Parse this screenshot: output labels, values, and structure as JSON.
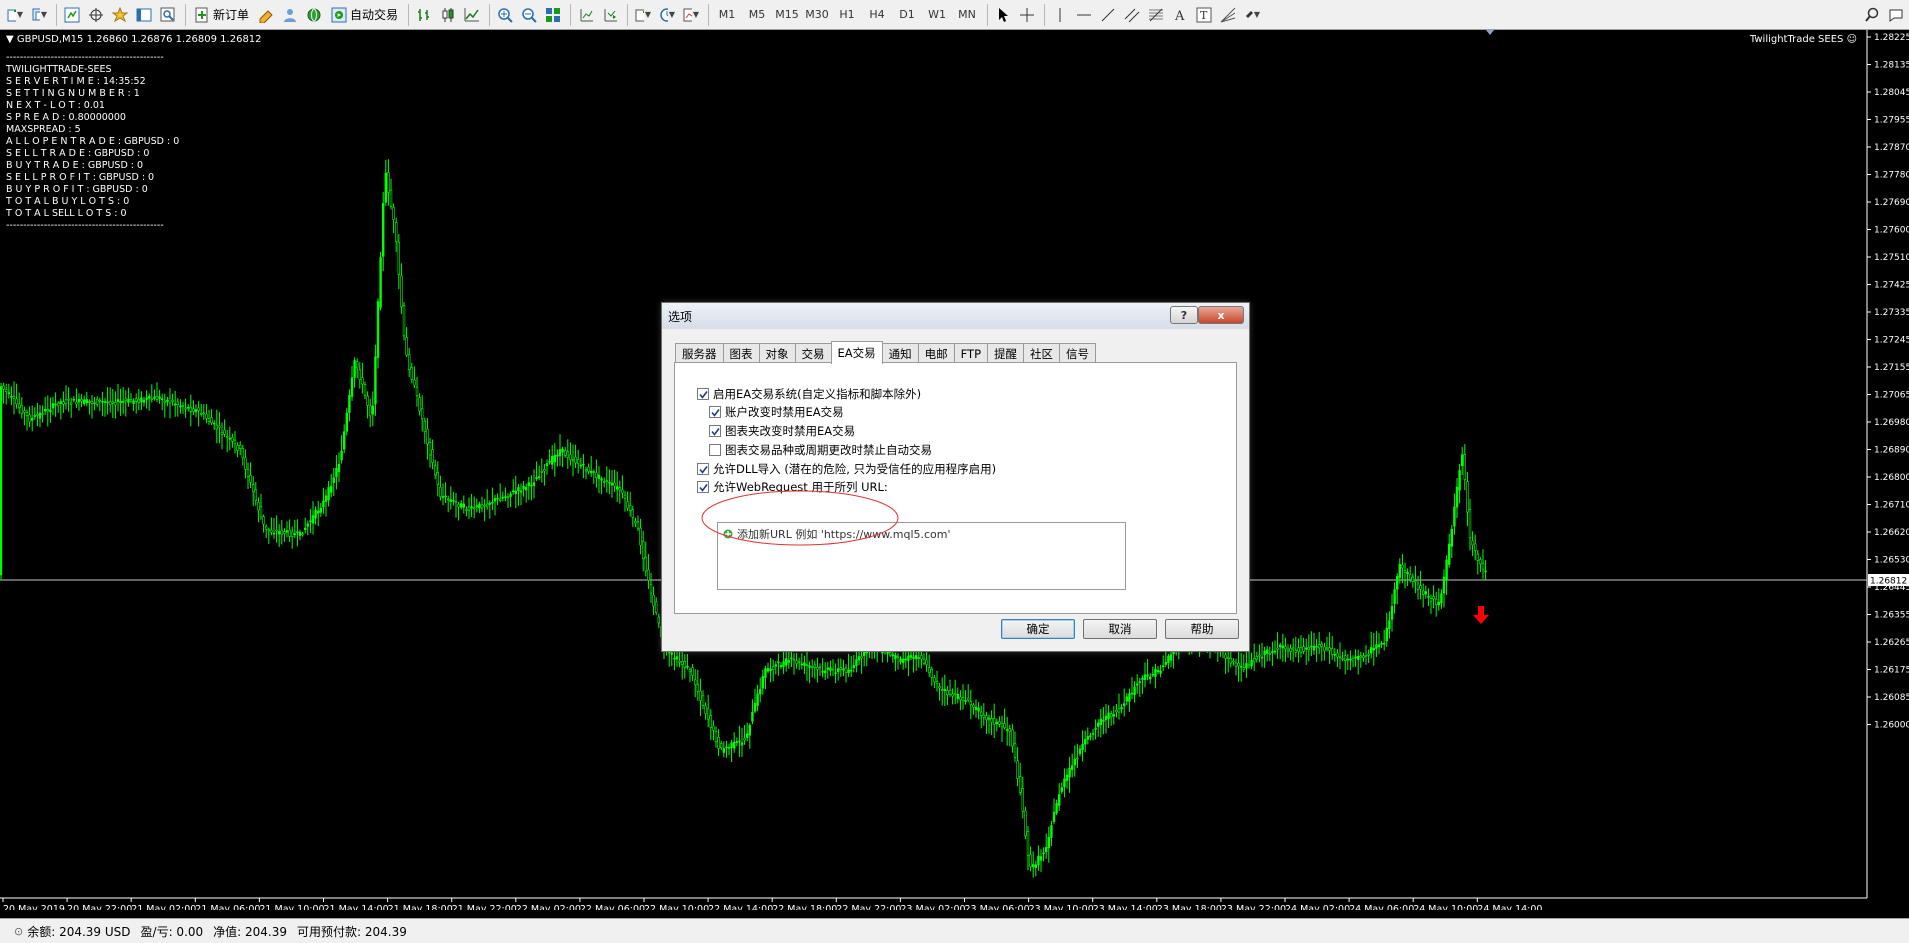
{
  "toolbar": {
    "new_order": "新订单",
    "auto_trading": "自动交易",
    "timeframes": [
      "M1",
      "M5",
      "M15",
      "M30",
      "H1",
      "H4",
      "D1",
      "W1",
      "MN"
    ]
  },
  "chart": {
    "title": "▼ GBPUSD,M15  1.26860 1.26876 1.26809 1.26812",
    "ea_name": "TwilightTrade SEES",
    "current_price": "1.26812",
    "price_labels": [
      "1.28225",
      "1.28135",
      "1.28045",
      "1.27955",
      "1.27870",
      "1.27780",
      "1.27690",
      "1.27600",
      "1.27510",
      "1.27425",
      "1.27335",
      "1.27245",
      "1.27155",
      "1.27065",
      "1.26980",
      "1.26890",
      "1.26800",
      "1.26710",
      "1.26620",
      "1.26530",
      "1.26445",
      "1.26355",
      "1.26265",
      "1.26175",
      "1.26085",
      "1.26000"
    ],
    "time_labels": [
      "20 May 2019",
      "20 May 22:00",
      "21 May 02:00",
      "21 May 06:00",
      "21 May 10:00",
      "21 May 14:00",
      "21 May 18:00",
      "21 May 22:00",
      "22 May 02:00",
      "22 May 06:00",
      "22 May 10:00",
      "22 May 14:00",
      "22 May 18:00",
      "22 May 22:00",
      "23 May 02:00",
      "23 May 06:00",
      "23 May 10:00",
      "23 May 14:00",
      "23 May 18:00",
      "23 May 22:00",
      "24 May 02:00",
      "24 May 06:00",
      "24 May 10:00",
      "24 May 14:00"
    ],
    "colors": {
      "candles": "#00ff00",
      "background": "#000000",
      "signal_arrow": "#ff0000"
    }
  },
  "ea_panel": {
    "lines": [
      "----------------------------------------------",
      "TWILIGHTTRADE-SEES",
      "S E R V E R  T I M E :  14:35:52",
      "S E T T I N G  N U M B E R :  1",
      "N E X T - L O T :  0.01",
      "S P R E A D :  0.80000000",
      "MAXSPREAD :  5",
      "A L L  O P E N  T R A D E : GBPUSD : 0",
      "S E L L T R A D E : GBPUSD : 0",
      "B U Y  T R A D E : GBPUSD : 0",
      "S E L L  P R O F I T : GBPUSD : 0",
      "B U Y   P R O F I T : GBPUSD : 0",
      "T O T A L  B U Y   L O T S  : 0",
      "T O T A L  SELL  L O T S : 0",
      "----------------------------------------------"
    ]
  },
  "dialog": {
    "title": "选项",
    "help_icon": "?",
    "close_icon": "x",
    "tabs": [
      "服务器",
      "图表",
      "对象",
      "交易",
      "EA交易",
      "通知",
      "电邮",
      "FTP",
      "提醒",
      "社区",
      "信号"
    ],
    "active_tab": "EA交易",
    "options": [
      {
        "label": "启用EA交易系统(自定义指标和脚本除外)",
        "checked": true
      },
      {
        "label": "账户改变时禁用EA交易",
        "checked": true
      },
      {
        "label": "图表夹改变时禁用EA交易",
        "checked": true
      },
      {
        "label": "图表交易品种或周期更改时禁止自动交易",
        "checked": false
      },
      {
        "label": "允许DLL导入 (潜在的危险, 只为受信任的应用程序启用)",
        "checked": true
      },
      {
        "label": "允许WebRequest 用于所列 URL:",
        "checked": true
      }
    ],
    "url_add": "添加新URL 例如 'https://www.mql5.com'",
    "buttons": {
      "ok": "确定",
      "cancel": "取消",
      "help": "帮助"
    }
  },
  "status_bar": {
    "balance": "余额: 204.39 USD",
    "profit": "盈/亏: 0.00",
    "equity": "净值: 204.39",
    "free_margin": "可用预付款: 204.39"
  }
}
